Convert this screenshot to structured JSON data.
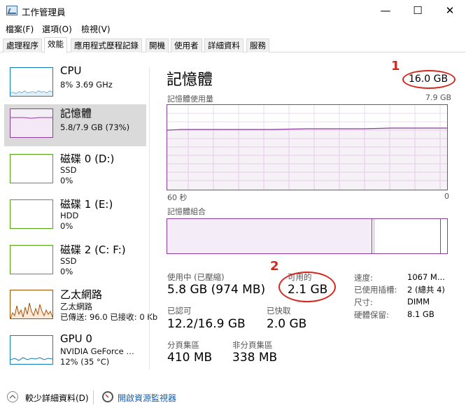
{
  "window": {
    "title": "工作管理員",
    "minimize": "—",
    "maximize": "☐",
    "close": "✕"
  },
  "menu": [
    {
      "label": "檔案(F)"
    },
    {
      "label": "選項(O)"
    },
    {
      "label": "檢視(V)"
    }
  ],
  "tabs": [
    {
      "label": "處理程序"
    },
    {
      "label": "效能"
    },
    {
      "label": "應用程式歷程記錄"
    },
    {
      "label": "開機"
    },
    {
      "label": "使用者"
    },
    {
      "label": "詳細資料"
    },
    {
      "label": "服務"
    }
  ],
  "resources": [
    {
      "name": "CPU",
      "line1": "8% 3.69 GHz",
      "line2": ""
    },
    {
      "name": "記憶體",
      "line1": "5.8/7.9 GB (73%)",
      "line2": ""
    },
    {
      "name": "磁碟 0 (D:)",
      "line1": "SSD",
      "line2": "0%"
    },
    {
      "name": "磁碟 1 (E:)",
      "line1": "HDD",
      "line2": "0%"
    },
    {
      "name": "磁碟 2 (C: F:)",
      "line1": "SSD",
      "line2": "0%"
    },
    {
      "name": "乙太網路",
      "line1": "乙太網路",
      "line2": "已傳送: 96.0 已接收: 0 Kb"
    },
    {
      "name": "GPU 0",
      "line1": "NVIDIA GeForce …",
      "line2": "12% (35 °C)"
    }
  ],
  "memory": {
    "title": "記憶體",
    "total": "16.0 GB",
    "usage_label": "記憶體使用量",
    "usage_max": "7.9 GB",
    "time_left": "60 秒",
    "time_right": "0",
    "composition_label": "記憶體組合",
    "in_use_label": "使用中 (已壓縮)",
    "in_use_value": "5.8 GB (974 MB)",
    "available_label": "可用的",
    "available_value": "2.1 GB",
    "committed_label": "已認可",
    "committed_value": "12.2/16.9 GB",
    "cached_label": "已快取",
    "cached_value": "2.0 GB",
    "paged_label": "分頁集區",
    "paged_value": "410 MB",
    "nonpaged_label": "非分頁集區",
    "nonpaged_value": "338 MB",
    "info": [
      {
        "k": "速度:",
        "v": "1067 M..."
      },
      {
        "k": "已使用插槽:",
        "v": "2 (總共 4)"
      },
      {
        "k": "尺寸:",
        "v": "DIMM"
      },
      {
        "k": "硬體保留:",
        "v": "8.1 GB"
      }
    ]
  },
  "annotations": {
    "one": "1",
    "two": "2"
  },
  "footer": {
    "fewer_details": "較少詳細資料(D)",
    "resource_monitor": "開啟資源監視器"
  },
  "colors": {
    "memory": "#8b3e9a",
    "cpu": "#117dbb",
    "disk": "#4da60c",
    "network": "#a74f01",
    "annotation": "#d7261e"
  }
}
